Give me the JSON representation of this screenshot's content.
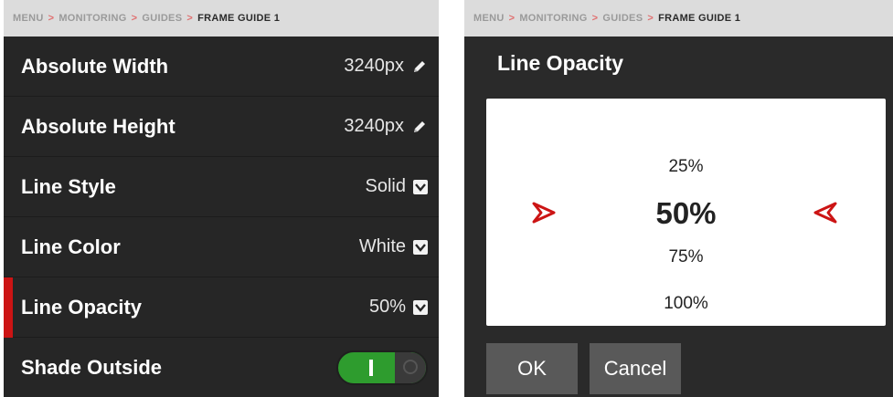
{
  "breadcrumb": {
    "items": [
      "MENU",
      "MONITORING",
      "GUIDES"
    ],
    "current": "FRAME GUIDE 1",
    "separator": ">"
  },
  "settings": [
    {
      "label": "Absolute Width",
      "value": "3240px",
      "control": "edit"
    },
    {
      "label": "Absolute Height",
      "value": "3240px",
      "control": "edit"
    },
    {
      "label": "Line Style",
      "value": "Solid",
      "control": "dropdown"
    },
    {
      "label": "Line Color",
      "value": "White",
      "control": "dropdown"
    },
    {
      "label": "Line Opacity",
      "value": "50%",
      "control": "dropdown"
    },
    {
      "label": "Shade Outside",
      "value": "",
      "control": "toggle",
      "on": true
    }
  ],
  "dialog": {
    "title": "Line Opacity",
    "options": [
      "25%",
      "50%",
      "75%",
      "100%"
    ],
    "selected": "50%",
    "ok_label": "OK",
    "cancel_label": "Cancel"
  },
  "colors": {
    "accent_red": "#cc1414",
    "toggle_green": "#2e9c2e",
    "panel_bg": "#262626",
    "breadcrumb_bg": "#dcdcdc"
  },
  "icons": [
    "pencil-icon",
    "chevron-down-icon",
    "arrow-right-icon",
    "arrow-left-icon"
  ]
}
